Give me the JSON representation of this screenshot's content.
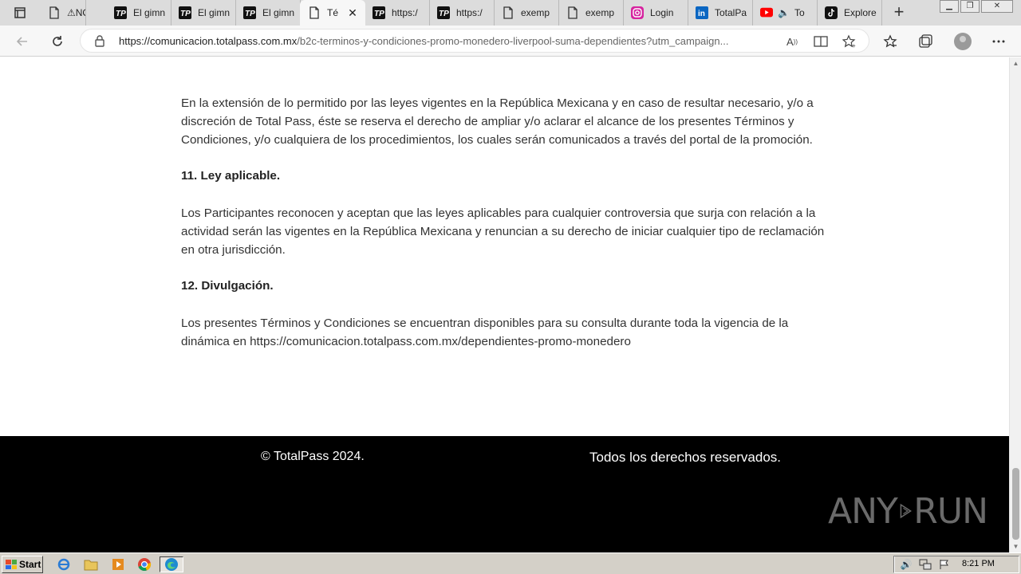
{
  "browser": {
    "tabs": [
      {
        "title": "⚠NO a",
        "icon": "page-icon"
      },
      {
        "title": "El gimn",
        "icon": "totalpass-icon"
      },
      {
        "title": "El gimn",
        "icon": "totalpass-icon"
      },
      {
        "title": "El gimn",
        "icon": "totalpass-icon"
      },
      {
        "title": "Té",
        "icon": "page-icon",
        "active": true
      },
      {
        "title": "https:/",
        "icon": "totalpass-icon"
      },
      {
        "title": "https:/",
        "icon": "totalpass-icon"
      },
      {
        "title": "exemp",
        "icon": "page-icon"
      },
      {
        "title": "exemp",
        "icon": "page-icon"
      },
      {
        "title": "Login",
        "icon": "instagram-icon"
      },
      {
        "title": "TotalPa",
        "icon": "linkedin-icon"
      },
      {
        "title": "To",
        "icon": "youtube-icon"
      },
      {
        "title": "Explore",
        "icon": "tiktok-icon"
      }
    ],
    "url_domain": "https://comunicacion.totalpass.com.mx",
    "url_path": "/b2c-terminos-y-condiciones-promo-monedero-liverpool-suma-dependientes?utm_campaign..."
  },
  "content": {
    "para_intro": "En la extensión de lo permitido por las leyes vigentes en la República Mexicana y en caso de resultar necesario, y/o a discreción de Total Pass, éste se reserva el derecho de ampliar y/o aclarar el alcance de los presentes Términos y Condiciones, y/o cualquiera de los procedimientos, los cuales serán comunicados a través del portal de la promoción.",
    "h11": "11. Ley aplicable.",
    "para_11": "Los Participantes reconocen y aceptan que las leyes aplicables para cualquier controversia que surja con relación a la actividad serán las vigentes en la República Mexicana y renuncian a su derecho de iniciar cualquier tipo de reclamación en otra jurisdicción.",
    "h12": "12. Divulgación.",
    "para_12": "Los presentes Términos y Condiciones se encuentran disponibles para su consulta durante toda la vigencia de la dinámica en https://comunicacion.totalpass.com.mx/dependientes-promo-monedero"
  },
  "footer": {
    "copyright": "© TotalPass 2024.",
    "rights": "Todos los derechos reservados.",
    "watermark_left": "ANY",
    "watermark_right": "RUN"
  },
  "taskbar": {
    "start": "Start",
    "clock": "8:21 PM"
  },
  "colors": {
    "footer_bg": "#000000",
    "text": "#333333"
  }
}
